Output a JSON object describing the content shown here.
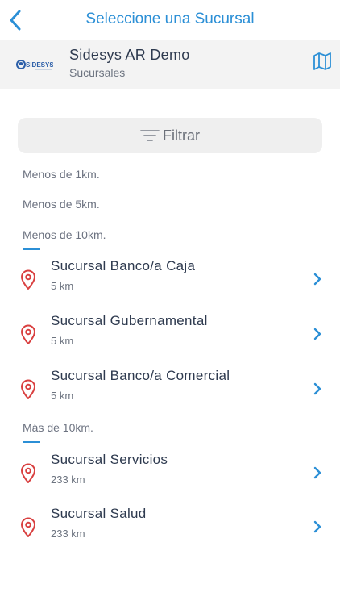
{
  "header": {
    "title": "Seleccione una Sucursal"
  },
  "company": {
    "logo_text": "SIDESYS",
    "name": "Sidesys AR Demo",
    "subtitle": "Sucursales"
  },
  "filter": {
    "label": "Filtrar"
  },
  "sections": {
    "s1": "Menos de 1km.",
    "s5": "Menos de 5km.",
    "s10": "Menos de 10km.",
    "s10plus": "Más de 10km."
  },
  "branches": [
    {
      "name": "Sucursal Banco/a Caja",
      "distance": "5 km"
    },
    {
      "name": "Sucursal Gubernamental",
      "distance": "5 km"
    },
    {
      "name": "Sucursal Banco/a Comercial",
      "distance": "5 km"
    },
    {
      "name": "Sucursal Servicios",
      "distance": "233 km"
    },
    {
      "name": "Sucursal Salud",
      "distance": "233 km"
    }
  ],
  "colors": {
    "accent": "#2b8fd6",
    "pin": "#d94040",
    "text": "#2e3a4f",
    "muted": "#6d7480"
  },
  "icons": {
    "back": "chevron-left-icon",
    "map": "map-icon",
    "filter": "filter-icon",
    "pin": "location-pin-icon",
    "row": "chevron-right-icon"
  }
}
